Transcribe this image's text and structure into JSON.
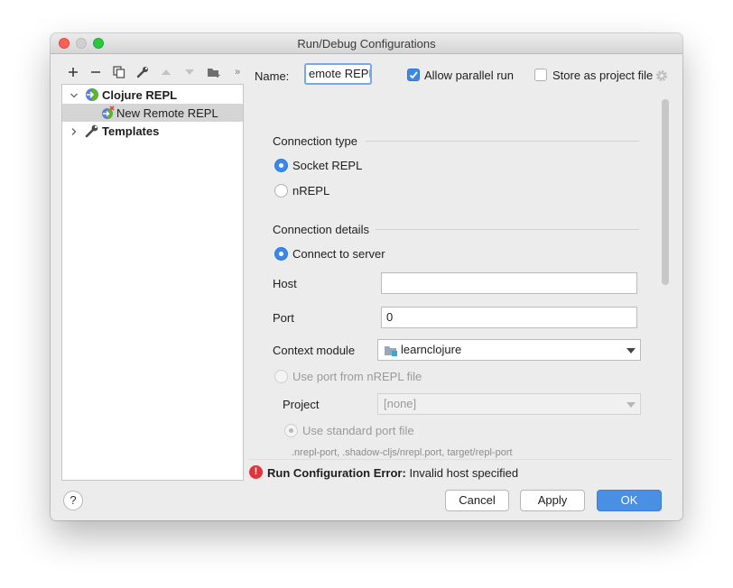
{
  "window": {
    "title": "Run/Debug Configurations"
  },
  "toolbar": {
    "items": [
      {
        "icon": "plus-icon"
      },
      {
        "icon": "minus-icon"
      },
      {
        "icon": "copy-icon"
      },
      {
        "icon": "wrench-icon"
      },
      {
        "icon": "move-up-icon"
      },
      {
        "icon": "move-down-icon"
      },
      {
        "icon": "new-folder-icon"
      },
      {
        "more": "»"
      }
    ]
  },
  "tree": {
    "root": {
      "label": "Clojure REPL",
      "expanded": true
    },
    "child": {
      "label": "New Remote REPL",
      "selected": true
    },
    "templates": {
      "label": "Templates",
      "expanded": false
    }
  },
  "header": {
    "name_label": "Name:",
    "name_value": "emote REPL",
    "allow_parallel_label": "Allow parallel run",
    "allow_parallel_checked": true,
    "store_as_project_label": "Store as project file",
    "store_as_project_checked": false
  },
  "connection_type": {
    "title": "Connection type",
    "options": [
      {
        "label": "Socket REPL",
        "selected": true
      },
      {
        "label": "nREPL",
        "selected": false
      }
    ]
  },
  "connection_details": {
    "title": "Connection details",
    "connect_to_server": "Connect to server",
    "host_label": "Host",
    "host_value": "",
    "port_label": "Port",
    "port_value": "0",
    "context_module_label": "Context module",
    "context_module_value": "learnclojure",
    "use_port_file_label": "Use port from nREPL file",
    "project_label": "Project",
    "project_value": "[none]",
    "use_standard_port_label": "Use standard port file",
    "port_file_hint": ".nrepl-port, .shadow-cljs/nrepl.port, target/repl-port"
  },
  "error": {
    "title": "Run Configuration Error:",
    "message": "Invalid host specified"
  },
  "footer": {
    "help": "?",
    "cancel": "Cancel",
    "apply": "Apply",
    "ok": "OK"
  },
  "colors": {
    "accent": "#3d88e5",
    "error": "#d9363e",
    "primary_button": "#4a8fe6"
  }
}
